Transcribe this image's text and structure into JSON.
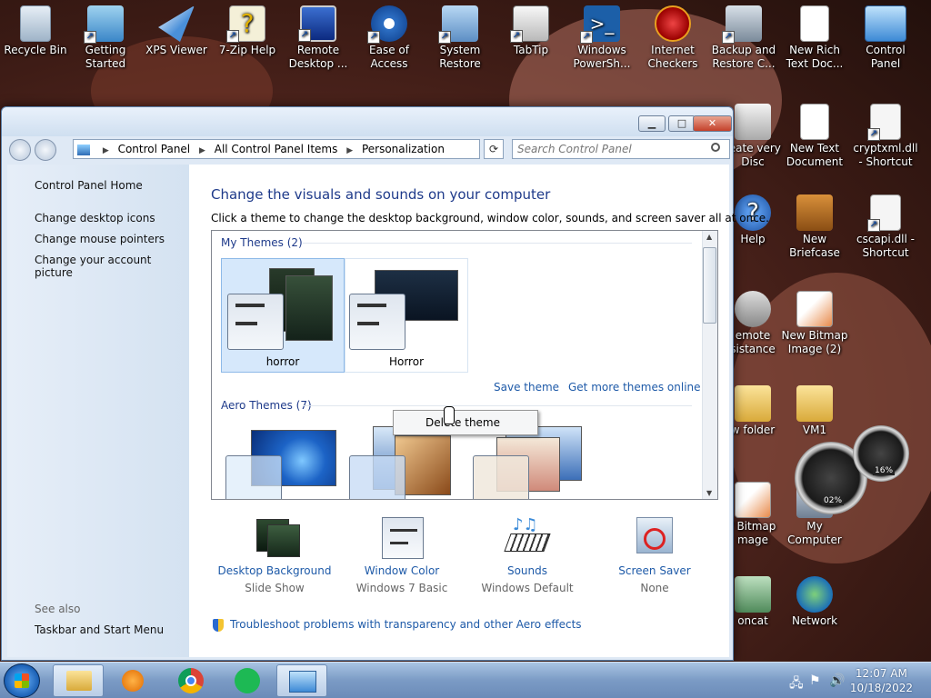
{
  "desktop": {
    "icons": [
      {
        "label": "Recycle Bin",
        "icon": "recycle-bin-icon"
      },
      {
        "label": "Getting Started",
        "icon": "getting-started-icon"
      },
      {
        "label": "XPS Viewer",
        "icon": "xps-viewer-icon"
      },
      {
        "label": "7-Zip Help",
        "icon": "help-file-icon"
      },
      {
        "label": "Remote Desktop ...",
        "icon": "remote-desktop-icon"
      },
      {
        "label": "Ease of Access",
        "icon": "ease-of-access-icon"
      },
      {
        "label": "System Restore",
        "icon": "system-restore-icon"
      },
      {
        "label": "TabTip",
        "icon": "tabtip-icon"
      },
      {
        "label": "Windows PowerSh...",
        "icon": "powershell-icon"
      },
      {
        "label": "Internet Checkers",
        "icon": "internet-checkers-icon"
      },
      {
        "label": "Backup and Restore C...",
        "icon": "backup-restore-icon"
      },
      {
        "label": "New Rich Text Doc...",
        "icon": "rich-text-doc-icon"
      },
      {
        "label": "Control Panel",
        "icon": "control-panel-icon"
      },
      {
        "label": "reate very Disc",
        "icon": "recovery-disc-icon"
      },
      {
        "label": "New Text Document",
        "icon": "text-document-icon"
      },
      {
        "label": "cryptxml.dll - Shortcut",
        "icon": "dll-shortcut-icon"
      },
      {
        "label": "Help",
        "icon": "help-icon"
      },
      {
        "label": "New Briefcase",
        "icon": "briefcase-icon"
      },
      {
        "label": "cscapi.dll - Shortcut",
        "icon": "dll-shortcut-icon"
      },
      {
        "label": "emote sistance",
        "icon": "remote-assistance-icon"
      },
      {
        "label": "New Bitmap Image (2)",
        "icon": "bitmap-image-icon"
      },
      {
        "label": "w folder",
        "icon": "folder-icon"
      },
      {
        "label": "VM1",
        "icon": "user-folder-icon"
      },
      {
        "label": "/ Bitmap mage",
        "icon": "bitmap-image-icon"
      },
      {
        "label": "My Computer",
        "icon": "computer-icon"
      },
      {
        "label": "oncat",
        "icon": "contact-icon"
      },
      {
        "label": "Network",
        "icon": "network-icon"
      }
    ],
    "gadget": {
      "cpu": "02%",
      "memory": "16%"
    }
  },
  "window": {
    "controls": {
      "minimize": "▁",
      "maximize": "□",
      "close": "✕"
    },
    "address": {
      "crumbs": [
        "Control Panel",
        "All Control Panel Items",
        "Personalization"
      ]
    },
    "search": {
      "placeholder": "Search Control Panel"
    },
    "left_pane": {
      "home": "Control Panel Home",
      "links": [
        "Change desktop icons",
        "Change mouse pointers",
        "Change your account picture"
      ],
      "see_also_title": "See also",
      "see_also_links": [
        "Taskbar and Start Menu"
      ]
    },
    "main": {
      "title": "Change the visuals and sounds on your computer",
      "subtitle": "Click a theme to change the desktop background, window color, sounds, and screen saver all at once.",
      "my_themes_label": "My Themes (2)",
      "my_themes": [
        {
          "name": "horror"
        },
        {
          "name": "Horror"
        }
      ],
      "save_theme": "Save theme",
      "get_more": "Get more themes online",
      "aero_label": "Aero Themes (7)",
      "context_menu": [
        "Delete theme"
      ],
      "bottom": [
        {
          "title": "Desktop Background",
          "value": "Slide Show"
        },
        {
          "title": "Window Color",
          "value": "Windows 7 Basic"
        },
        {
          "title": "Sounds",
          "value": "Windows Default"
        },
        {
          "title": "Screen Saver",
          "value": "None"
        }
      ],
      "troubleshoot": "Troubleshoot problems with transparency and other Aero effects"
    }
  },
  "taskbar": {
    "apps": [
      "windows-explorer",
      "media-player",
      "chrome",
      "spotify",
      "control-panel"
    ],
    "time": "12:07 AM",
    "date": "10/18/2022"
  }
}
